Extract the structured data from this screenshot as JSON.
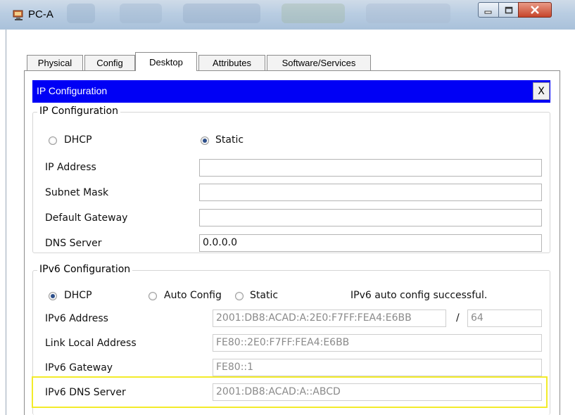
{
  "window": {
    "title": "PC-A"
  },
  "tabs": [
    "Physical",
    "Config",
    "Desktop",
    "Attributes",
    "Software/Services"
  ],
  "ip_config": {
    "header": "IP Configuration",
    "close_label": "X",
    "group_title": "IP Configuration",
    "dhcp_label": "DHCP",
    "static_label": "Static",
    "ip_address_label": "IP Address",
    "ip_address_value": "",
    "subnet_mask_label": "Subnet Mask",
    "subnet_mask_value": "",
    "default_gateway_label": "Default Gateway",
    "default_gateway_value": "",
    "dns_server_label": "DNS Server",
    "dns_server_value": "0.0.0.0"
  },
  "ipv6_config": {
    "group_title": "IPv6 Configuration",
    "dhcp_label": "DHCP",
    "auto_config_label": "Auto Config",
    "static_label": "Static",
    "status_text": "IPv6 auto config successful.",
    "ipv6_address_label": "IPv6 Address",
    "ipv6_address_value": "2001:DB8:ACAD:A:2E0:F7FF:FEA4:E6BB",
    "prefix_separator": "/",
    "prefix_value": "64",
    "link_local_label": "Link Local Address",
    "link_local_value": "FE80::2E0:F7FF:FEA4:E6BB",
    "gateway_label": "IPv6 Gateway",
    "gateway_value": "FE80::1",
    "dns_server_label": "IPv6 DNS Server",
    "dns_server_value": "2001:DB8:ACAD:A::ABCD"
  },
  "colors": {
    "header_blue": "#0000f5",
    "highlight_yellow": "#f3ec2a"
  },
  "icons": {
    "app": "packet-tracer-pc-icon",
    "minimize": "minimize-icon",
    "maximize": "maximize-icon",
    "close": "close-icon"
  }
}
